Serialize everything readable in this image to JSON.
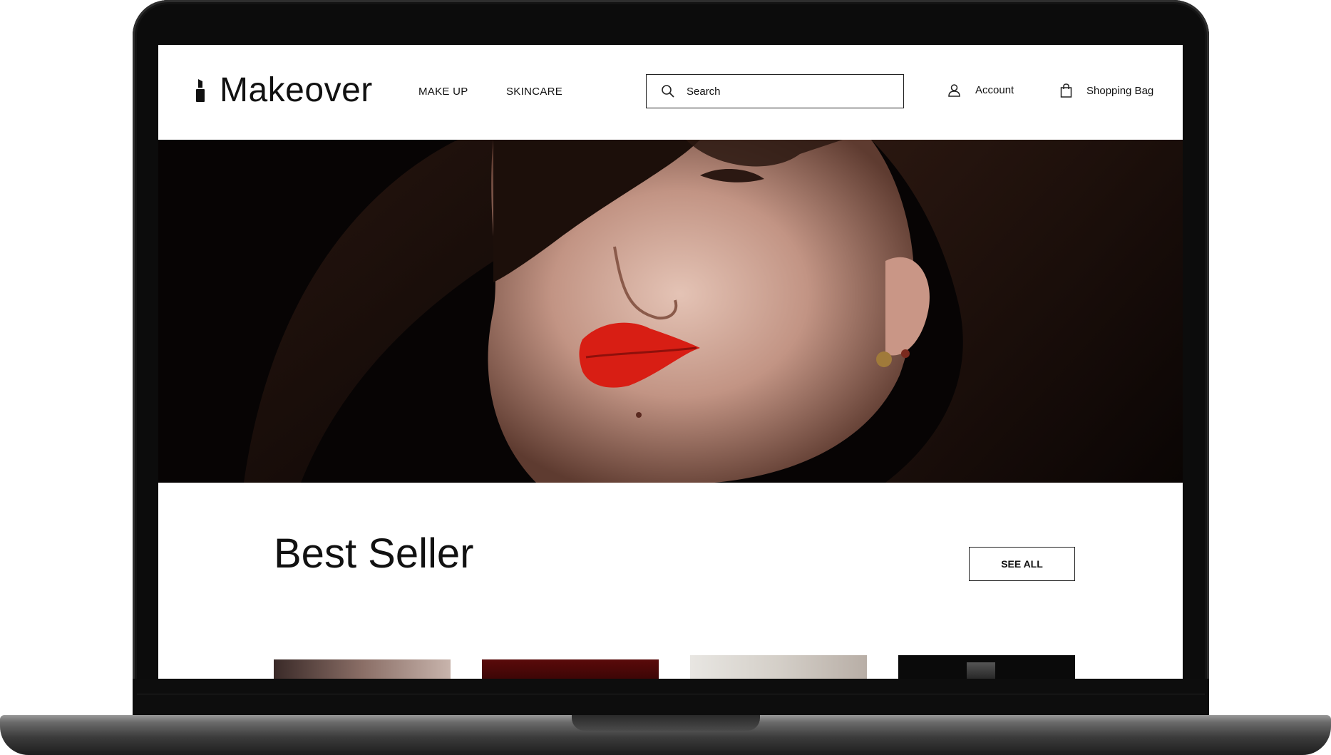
{
  "brand": {
    "name": "Makeover",
    "logo_icon": "lipstick-icon"
  },
  "nav": [
    {
      "label": "MAKE UP"
    },
    {
      "label": "SKINCARE"
    }
  ],
  "search": {
    "placeholder": "Search",
    "icon": "search-icon"
  },
  "header_links": {
    "account": {
      "label": "Account",
      "icon": "user-icon"
    },
    "bag": {
      "label": "Shopping Bag",
      "icon": "shopping-bag-icon"
    }
  },
  "best_seller": {
    "title": "Best Seller",
    "see_all_label": "SEE ALL"
  },
  "colors": {
    "text": "#111111",
    "accent_lip": "#d81e14",
    "frame": "#0c0c0c"
  }
}
